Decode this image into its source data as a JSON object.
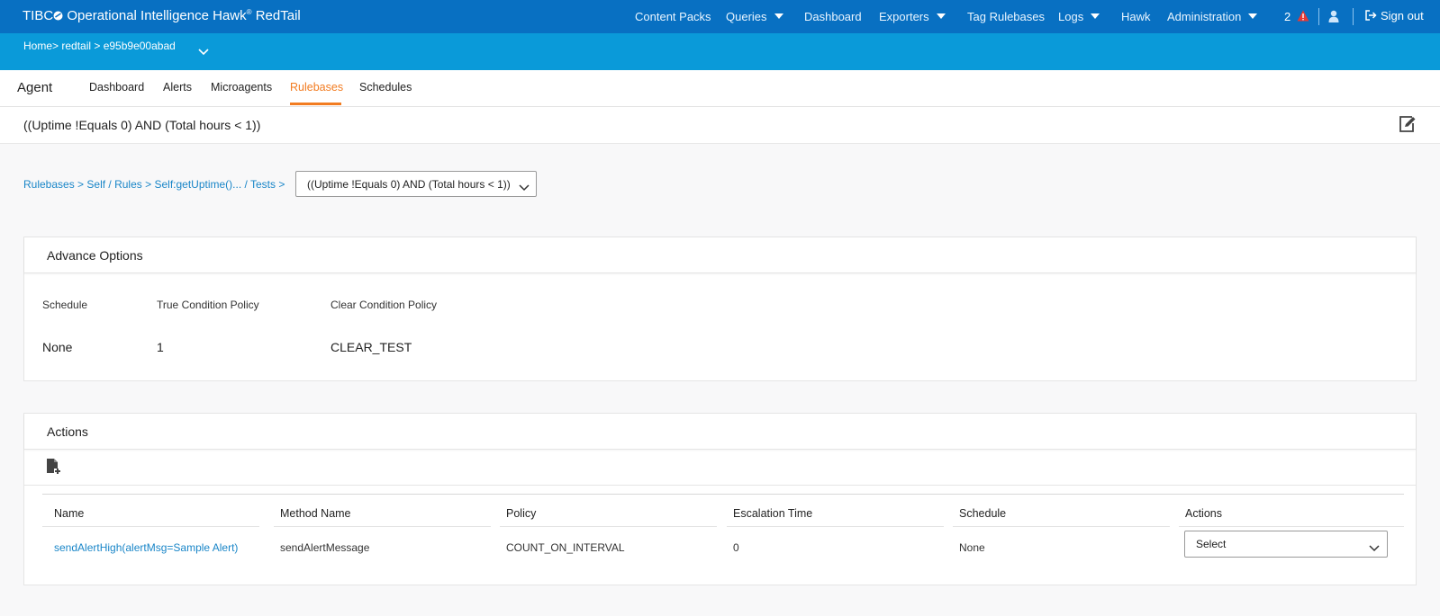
{
  "app": {
    "brand_prefix": "TIBC",
    "brand_name": "Operational Intelligence Hawk",
    "brand_tm": "®",
    "brand_suffix": "RedTail"
  },
  "topnav": {
    "items": [
      {
        "label": "Content Packs"
      },
      {
        "label": "Queries"
      },
      {
        "label": "Dashboard"
      },
      {
        "label": "Exporters"
      },
      {
        "label": "Tag Rulebases"
      },
      {
        "label": "Logs"
      },
      {
        "label": "Hawk"
      },
      {
        "label": "Administration"
      }
    ],
    "alert_count": "2",
    "signout_label": "Sign out"
  },
  "breadcrumb_band": {
    "text": "Home> redtail > e95b9e00abad"
  },
  "agent": {
    "title": "Agent",
    "tabs": [
      {
        "label": "Dashboard"
      },
      {
        "label": "Alerts"
      },
      {
        "label": "Microagents"
      },
      {
        "label": "Rulebases"
      },
      {
        "label": "Schedules"
      }
    ],
    "active_tab": "Rulebases"
  },
  "rule": {
    "title": "((Uptime !Equals 0) AND (Total hours < 1))"
  },
  "crumbs": {
    "rulebases": "Rulebases",
    "sep1": ">",
    "self_rules": "Self / Rules",
    "sep2": ">",
    "method": "Self:getUptime()...",
    "tests": "/ Tests",
    "sep3": ">",
    "selected_test": "((Uptime !Equals 0) AND (Total hours < 1))"
  },
  "advance_options": {
    "title": "Advance Options",
    "labels": {
      "schedule": "Schedule",
      "true_policy": "True Condition Policy",
      "clear_policy": "Clear Condition Policy"
    },
    "values": {
      "schedule": "None",
      "true_policy": "1",
      "clear_policy": "CLEAR_TEST"
    }
  },
  "actions_panel": {
    "title": "Actions",
    "columns": [
      "Name",
      "Method Name",
      "Policy",
      "Escalation Time",
      "Schedule",
      "Actions"
    ],
    "rows": [
      {
        "name": "sendAlertHigh(alertMsg=Sample Alert)",
        "method": "sendAlertMessage",
        "policy": "COUNT_ON_INTERVAL",
        "escalation": "0",
        "schedule": "None",
        "action_select": "Select"
      }
    ]
  },
  "colors": {
    "topbar": "#0870c2",
    "band": "#0a9ad9",
    "active_tab": "#f27c21",
    "link": "#1a86c8",
    "alert": "#e53935"
  },
  "icons": {
    "alert": "warning-triangle-icon",
    "user": "user-icon",
    "signout": "sign-out-icon",
    "edit": "edit-icon",
    "add": "add-document-icon",
    "chevron": "chevron-down-icon"
  }
}
